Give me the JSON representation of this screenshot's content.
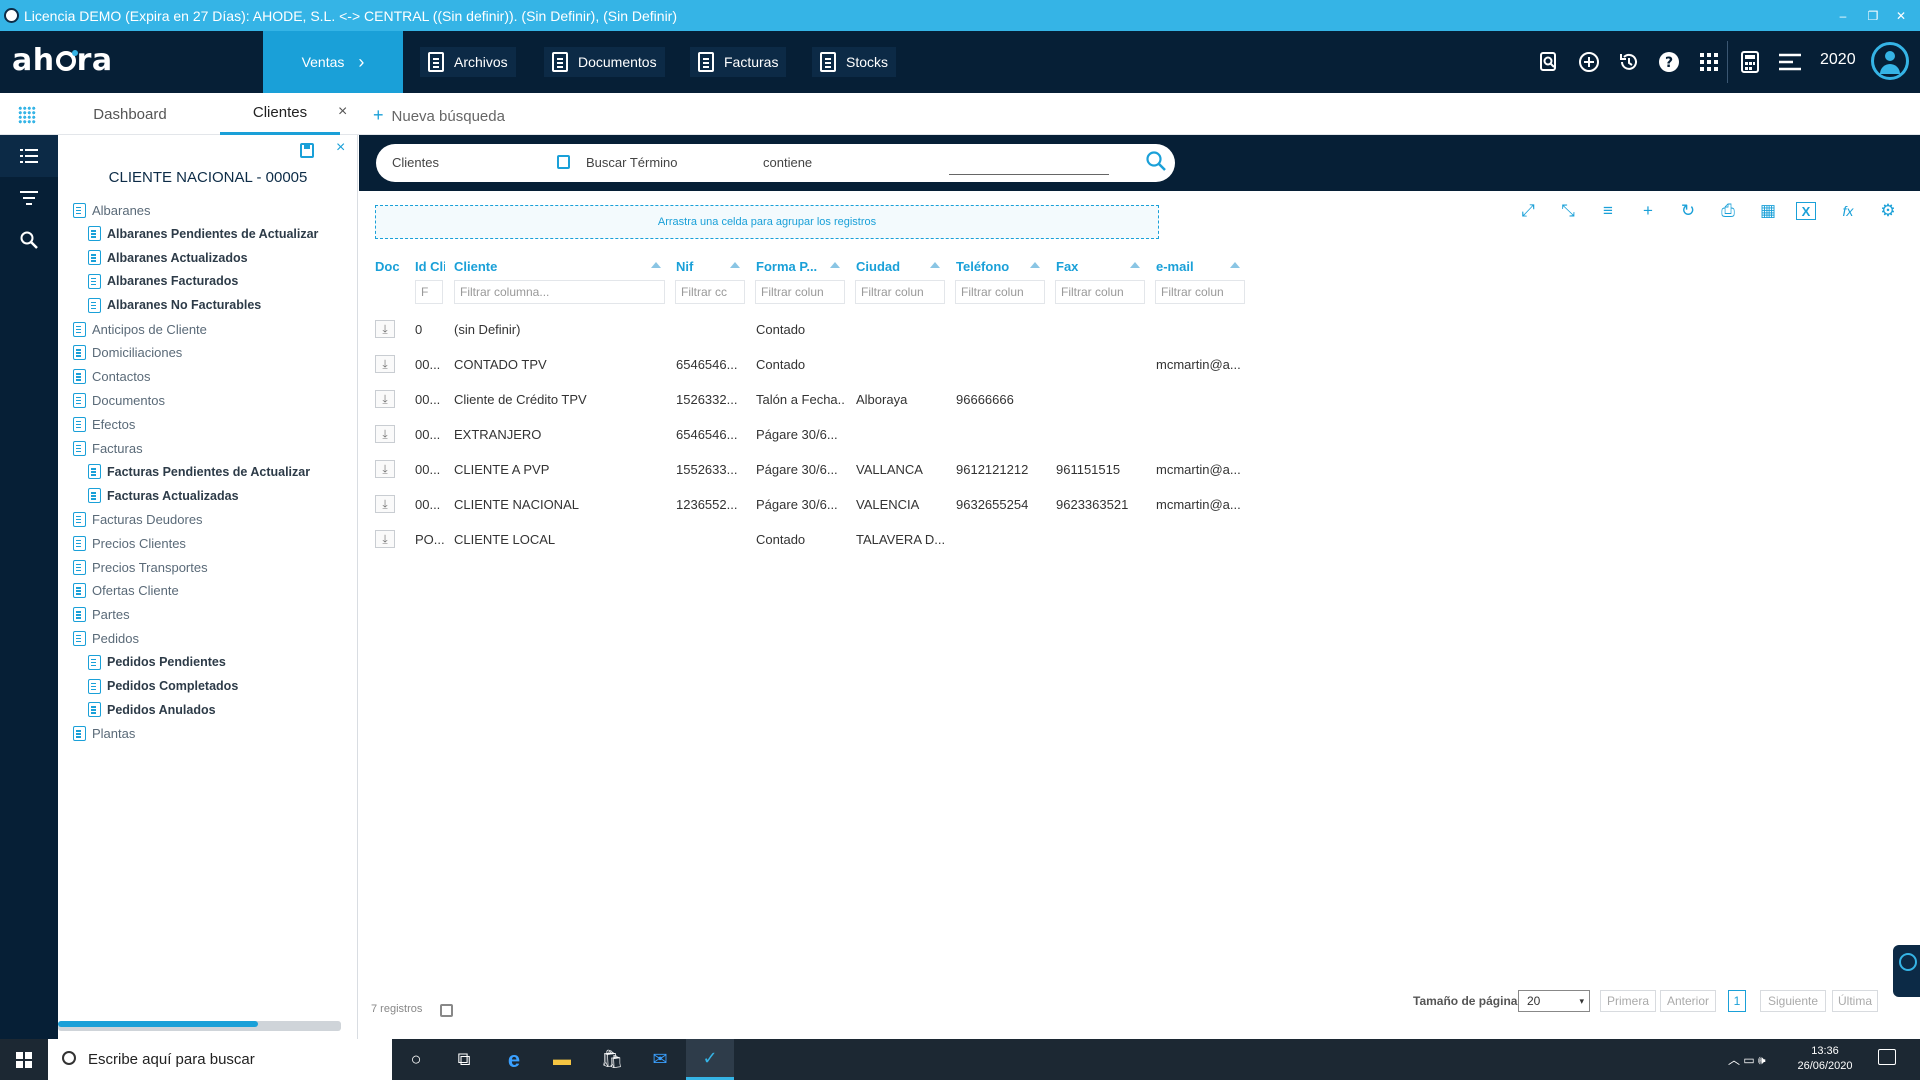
{
  "titlebar": {
    "text": "Licencia DEMO (Expira en 27 Días): AHODE, S.L. <-> CENTRAL ((Sin definir)). (Sin Definir), (Sin Definir)",
    "minimize": "‒",
    "restore": "❐",
    "close": "✕"
  },
  "header": {
    "brand": {
      "a": "ah",
      "b": "ra"
    },
    "active_module": "Ventas",
    "active_module_chevron": "›",
    "menus": [
      "Archivos",
      "Documentos",
      "Facturas",
      "Stocks"
    ],
    "year": "2020",
    "icons": [
      "search-doc-icon",
      "add-circle-icon",
      "history-icon",
      "help-icon",
      "apps-grid-icon",
      "calculator-icon",
      "menu-settings-icon",
      "user-avatar-icon"
    ]
  },
  "tabs": {
    "dashboard": "Dashboard",
    "clientes": "Clientes",
    "close": "×",
    "new_search_plus": "+",
    "new_search": "Nueva búsqueda"
  },
  "panel": {
    "title": "CLIENTE NACIONAL - 00005",
    "close": "×",
    "tree": [
      {
        "label": "Albaranes",
        "level": 0
      },
      {
        "label": "Albaranes Pendientes de Actualizar",
        "level": 1
      },
      {
        "label": "Albaranes Actualizados",
        "level": 1
      },
      {
        "label": "Albaranes Facturados",
        "level": 1
      },
      {
        "label": "Albaranes No Facturables",
        "level": 1
      },
      {
        "label": "Anticipos de Cliente",
        "level": 0
      },
      {
        "label": "Domiciliaciones",
        "level": 0
      },
      {
        "label": "Contactos",
        "level": 0
      },
      {
        "label": "Documentos",
        "level": 0
      },
      {
        "label": "Efectos",
        "level": 0
      },
      {
        "label": "Facturas",
        "level": 0
      },
      {
        "label": "Facturas Pendientes de Actualizar",
        "level": 1
      },
      {
        "label": "Facturas Actualizadas",
        "level": 1
      },
      {
        "label": "Facturas Deudores",
        "level": 0
      },
      {
        "label": "Precios Clientes",
        "level": 0
      },
      {
        "label": "Precios Transportes",
        "level": 0
      },
      {
        "label": "Ofertas Cliente",
        "level": 0
      },
      {
        "label": "Partes",
        "level": 0
      },
      {
        "label": "Pedidos",
        "level": 0
      },
      {
        "label": "Pedidos Pendientes",
        "level": 1
      },
      {
        "label": "Pedidos Completados",
        "level": 1
      },
      {
        "label": "Pedidos Anulados",
        "level": 1
      },
      {
        "label": "Plantas",
        "level": 0
      }
    ]
  },
  "search": {
    "entity": "Clientes",
    "term_label": "Buscar Término",
    "operator": "contiene",
    "value": ""
  },
  "grid": {
    "drop_hint": "Arrastra una celda para agrupar los registros",
    "toolbar_icons": [
      "expand-icon",
      "collapse-icon",
      "clear-filter-icon",
      "add-icon",
      "refresh-icon",
      "print-icon",
      "layout-icon",
      "excel-icon",
      "formula-icon",
      "settings-icon"
    ],
    "toolbar_glyphs": [
      "⤢",
      "⤡",
      "≡",
      "+",
      "↻",
      "⎙",
      "▦",
      "X",
      "fx",
      "⚙"
    ],
    "columns": [
      {
        "label": "Doc",
        "filter": ""
      },
      {
        "label": "Id Cli",
        "filter": "F"
      },
      {
        "label": "Cliente",
        "filter": "Filtrar columna..."
      },
      {
        "label": "Nif",
        "filter": "Filtrar cc"
      },
      {
        "label": "Forma P...",
        "filter": "Filtrar colun"
      },
      {
        "label": "Ciudad",
        "filter": "Filtrar colun"
      },
      {
        "label": "Teléfono",
        "filter": "Filtrar colun"
      },
      {
        "label": "Fax",
        "filter": "Filtrar colun"
      },
      {
        "label": "e-mail",
        "filter": "Filtrar colun"
      }
    ],
    "download_glyph": "⤓",
    "rows": [
      {
        "id": "0",
        "cliente": "(sin Definir)",
        "nif": "",
        "forma": "Contado",
        "ciudad": "",
        "telefono": "",
        "fax": "",
        "email": ""
      },
      {
        "id": "00...",
        "cliente": "CONTADO TPV",
        "nif": "6546546...",
        "forma": "Contado",
        "ciudad": "",
        "telefono": "",
        "fax": "",
        "email": "mcmartin@a..."
      },
      {
        "id": "00...",
        "cliente": "Cliente de Crédito TPV",
        "nif": "1526332...",
        "forma": "Talón a Fecha...",
        "ciudad": "Alboraya",
        "telefono": "96666666",
        "fax": "",
        "email": ""
      },
      {
        "id": "00...",
        "cliente": "EXTRANJERO",
        "nif": "6546546...",
        "forma": "Págare 30/6...",
        "ciudad": "",
        "telefono": "",
        "fax": "",
        "email": ""
      },
      {
        "id": "00...",
        "cliente": "CLIENTE A PVP",
        "nif": "1552633...",
        "forma": "Págare 30/6...",
        "ciudad": "VALLANCA",
        "telefono": "9612121212",
        "fax": "961151515",
        "email": "mcmartin@a..."
      },
      {
        "id": "00...",
        "cliente": "CLIENTE NACIONAL",
        "nif": "1236552...",
        "forma": "Págare 30/6...",
        "ciudad": "VALENCIA",
        "telefono": "9632655254",
        "fax": "9623363521",
        "email": "mcmartin@a..."
      },
      {
        "id": "PO...",
        "cliente": "CLIENTE LOCAL",
        "nif": "",
        "forma": "Contado",
        "ciudad": "TALAVERA D...",
        "telefono": "",
        "fax": "",
        "email": ""
      }
    ]
  },
  "footer": {
    "records": "7 registros",
    "page_size_label": "Tamaño de página",
    "page_size": "20",
    "page_size_arrow": "▾",
    "first": "Primera",
    "prev": "Anterior",
    "current": "1",
    "next": "Siguiente",
    "last": "Última"
  },
  "taskbar": {
    "search_placeholder": "Escribe aquí para buscar",
    "time": "13:36",
    "date": "26/06/2020",
    "icon_glyphs": [
      "○",
      "⧉",
      "e",
      "▬",
      "🛍",
      "✉",
      "✓"
    ],
    "tray_glyphs": "︿ ▭ 🕪"
  },
  "colors": {
    "accent": "#1aa0d8",
    "titlebar": "#35b4e6",
    "header": "#061f36"
  }
}
